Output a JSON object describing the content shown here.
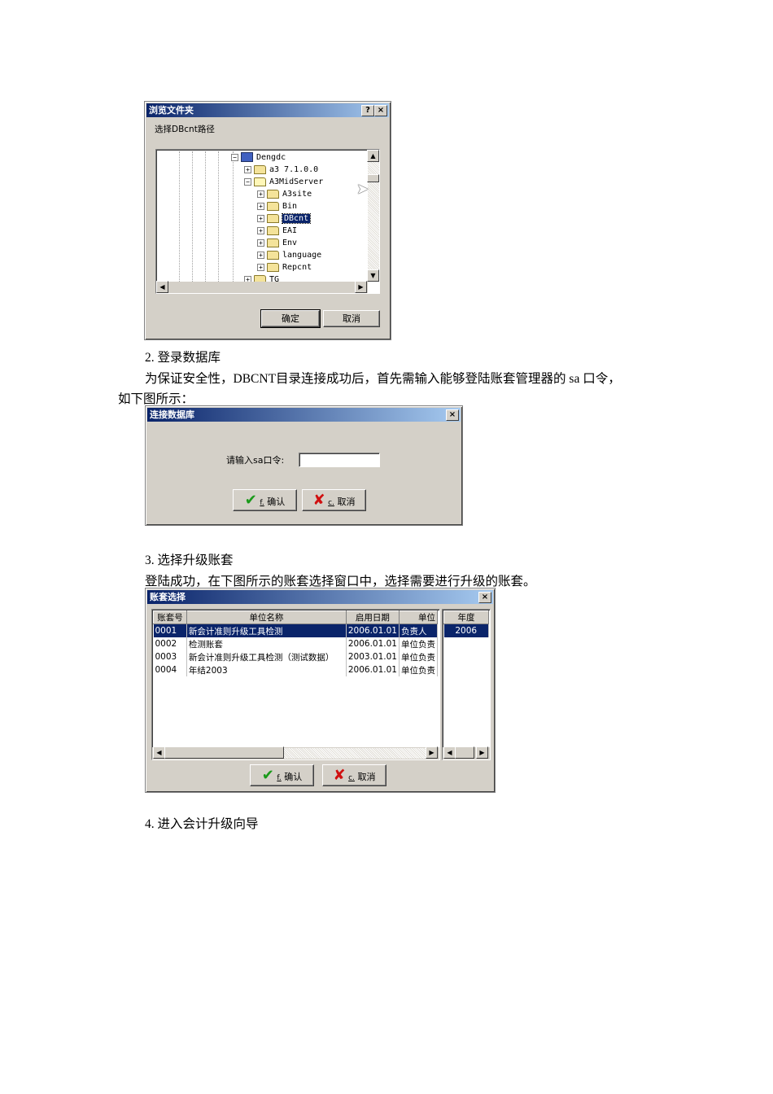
{
  "browse_dialog": {
    "title": "浏览文件夹",
    "prompt": "选择DBcnt路径",
    "tree": [
      {
        "label": "Dengdc",
        "icon": "computer-icon",
        "expander": "−"
      },
      {
        "label": "a3 7.1.0.0",
        "icon": "folder-icon",
        "expander": "+"
      },
      {
        "label": "A3MidServer",
        "icon": "open-folder-icon",
        "expander": "−"
      },
      {
        "label": "A3site",
        "icon": "folder-icon",
        "expander": "+"
      },
      {
        "label": "Bin",
        "icon": "folder-icon",
        "expander": "+"
      },
      {
        "label": "DBcnt",
        "icon": "folder-icon",
        "expander": "+",
        "selected": true
      },
      {
        "label": "EAI",
        "icon": "folder-icon",
        "expander": "+"
      },
      {
        "label": "Env",
        "icon": "folder-icon",
        "expander": "+"
      },
      {
        "label": "language",
        "icon": "folder-icon",
        "expander": "+"
      },
      {
        "label": "Repcnt",
        "icon": "folder-icon",
        "expander": "+"
      },
      {
        "label": "TG",
        "icon": "folder-icon",
        "expander": "+"
      }
    ],
    "ok_label": "确定",
    "cancel_label": "取消",
    "help_label": "?",
    "close_label": "×"
  },
  "step2": {
    "heading": "2.    登录数据库",
    "body_line1": "为保证安全性，DBCNT目录连接成功后，首先需输入能够登陆账套管理器的 sa 口令，",
    "body_line2": "如下图所示："
  },
  "connect_dialog": {
    "title": "连接数据库",
    "close_label": "×",
    "password_label": "请输入sa口令:",
    "password_value": "",
    "ok_label": "确认",
    "ok_hotkey": "f.",
    "cancel_label": "取消",
    "cancel_hotkey": "c."
  },
  "step3": {
    "heading": "3.    选择升级账套",
    "body": "登陆成功，在下图所示的账套选择窗口中，选择需要进行升级的账套。"
  },
  "account_dialog": {
    "title": "账套选择",
    "close_label": "×",
    "columns": [
      "账套号",
      "单位名称",
      "启用日期",
      "单位"
    ],
    "rows": [
      [
        "0001",
        "新会计准则升级工具检测",
        "2006.01.01",
        "负责人"
      ],
      [
        "0002",
        "检测账套",
        "2006.01.01",
        "单位负责"
      ],
      [
        "0003",
        "新会计准则升级工具检测（测试数据）",
        "2003.01.01",
        "单位负责"
      ],
      [
        "0004",
        "年结2003",
        "2006.01.01",
        "单位负责"
      ]
    ],
    "year_header": "年度",
    "years": [
      "2006"
    ],
    "ok_label": "确认",
    "ok_hotkey": "f.",
    "cancel_label": "取消",
    "cancel_hotkey": "c."
  },
  "step4": {
    "heading": "4.    进入会计升级向导"
  }
}
